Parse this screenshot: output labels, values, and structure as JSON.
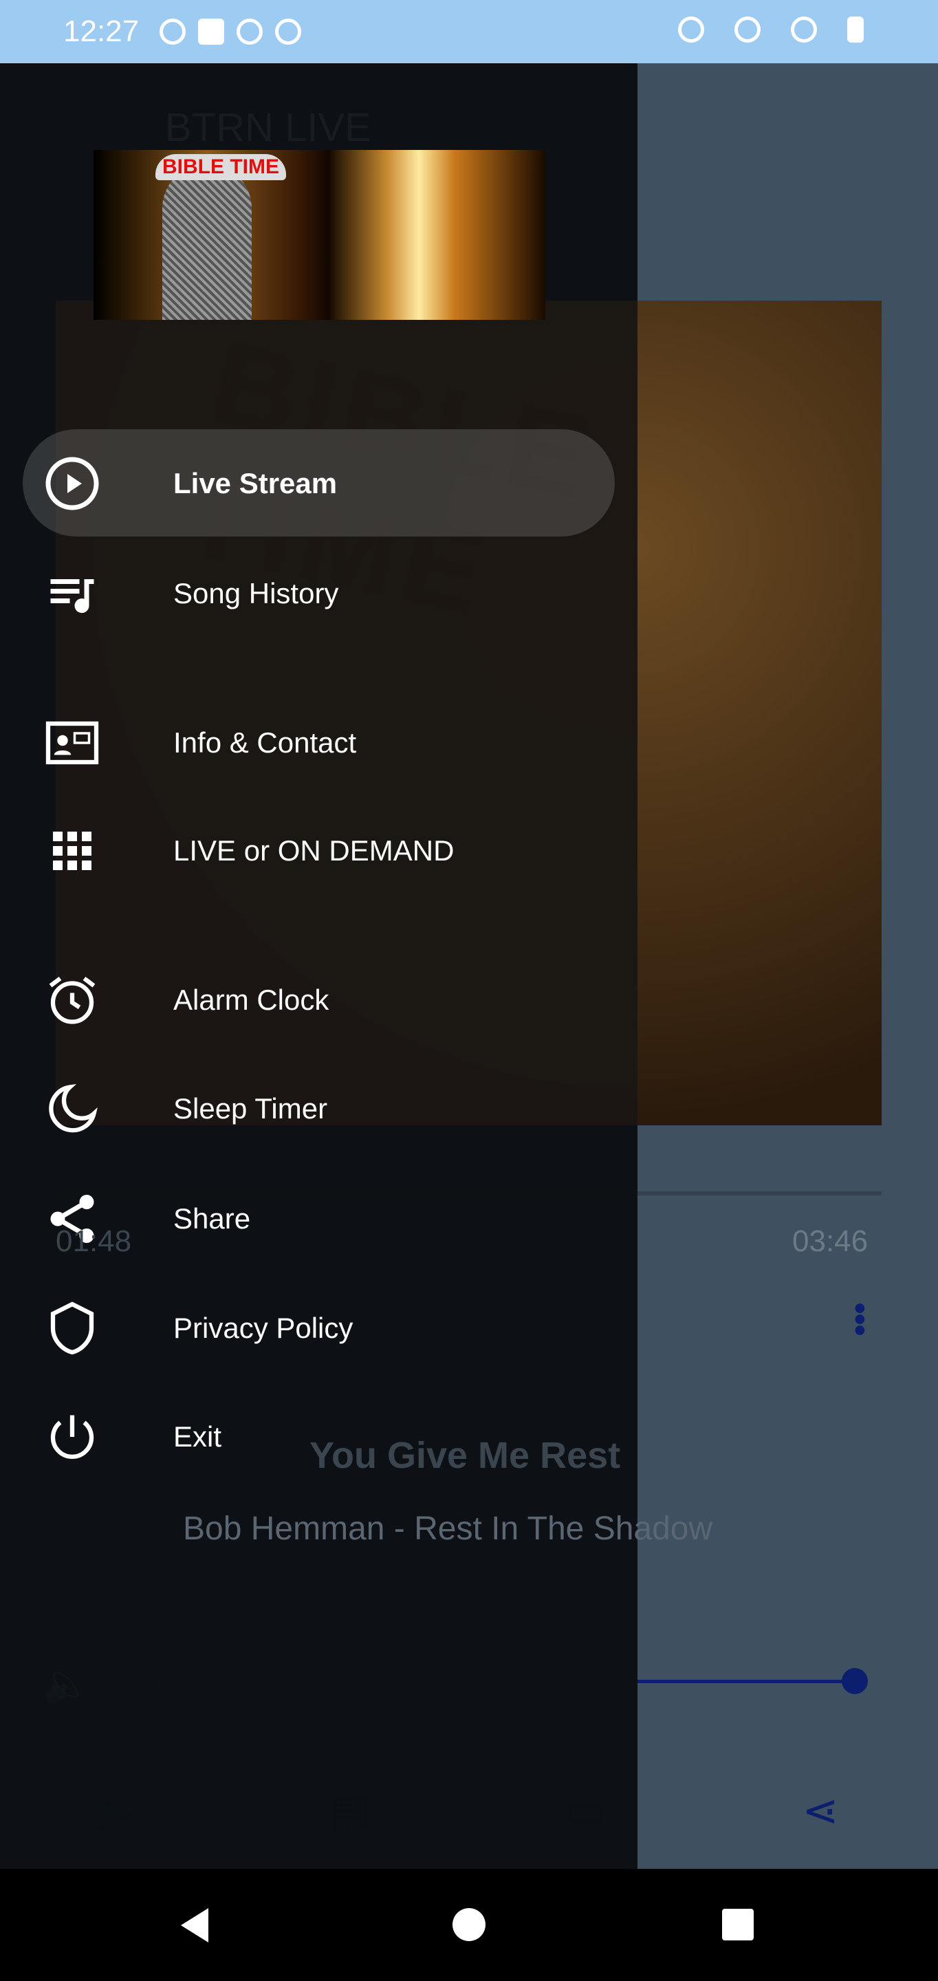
{
  "status_bar": {
    "time": "12:27"
  },
  "app": {
    "title": "BTRN LIVE",
    "art_text": "BIBLE TIME",
    "elapsed": "01:48",
    "duration": "03:46",
    "song_title": "You Give Me Rest",
    "song_artist": "Bob Hemman - Rest In The Shadow",
    "volume_percent": 100,
    "progress_percent": 48
  },
  "drawer": {
    "header_logo_text": "BIBLE TIME",
    "items": [
      {
        "label": "Live Stream",
        "icon": "play-circle-icon",
        "active": true
      },
      {
        "label": "Song History",
        "icon": "playlist-icon"
      },
      {
        "label": "Info & Contact",
        "icon": "contact-card-icon"
      },
      {
        "label": "LIVE or ON DEMAND",
        "icon": "grid-icon"
      },
      {
        "label": "Alarm Clock",
        "icon": "alarm-icon"
      },
      {
        "label": "Sleep Timer",
        "icon": "moon-icon"
      },
      {
        "label": "Share",
        "icon": "share-icon"
      },
      {
        "label": "Privacy Policy",
        "icon": "shield-icon"
      },
      {
        "label": "Exit",
        "icon": "power-icon"
      }
    ]
  },
  "colors": {
    "accent": "#0b1f6e",
    "status_bar": "#9ecbf2",
    "drawer_bg": "#0b0f13"
  }
}
